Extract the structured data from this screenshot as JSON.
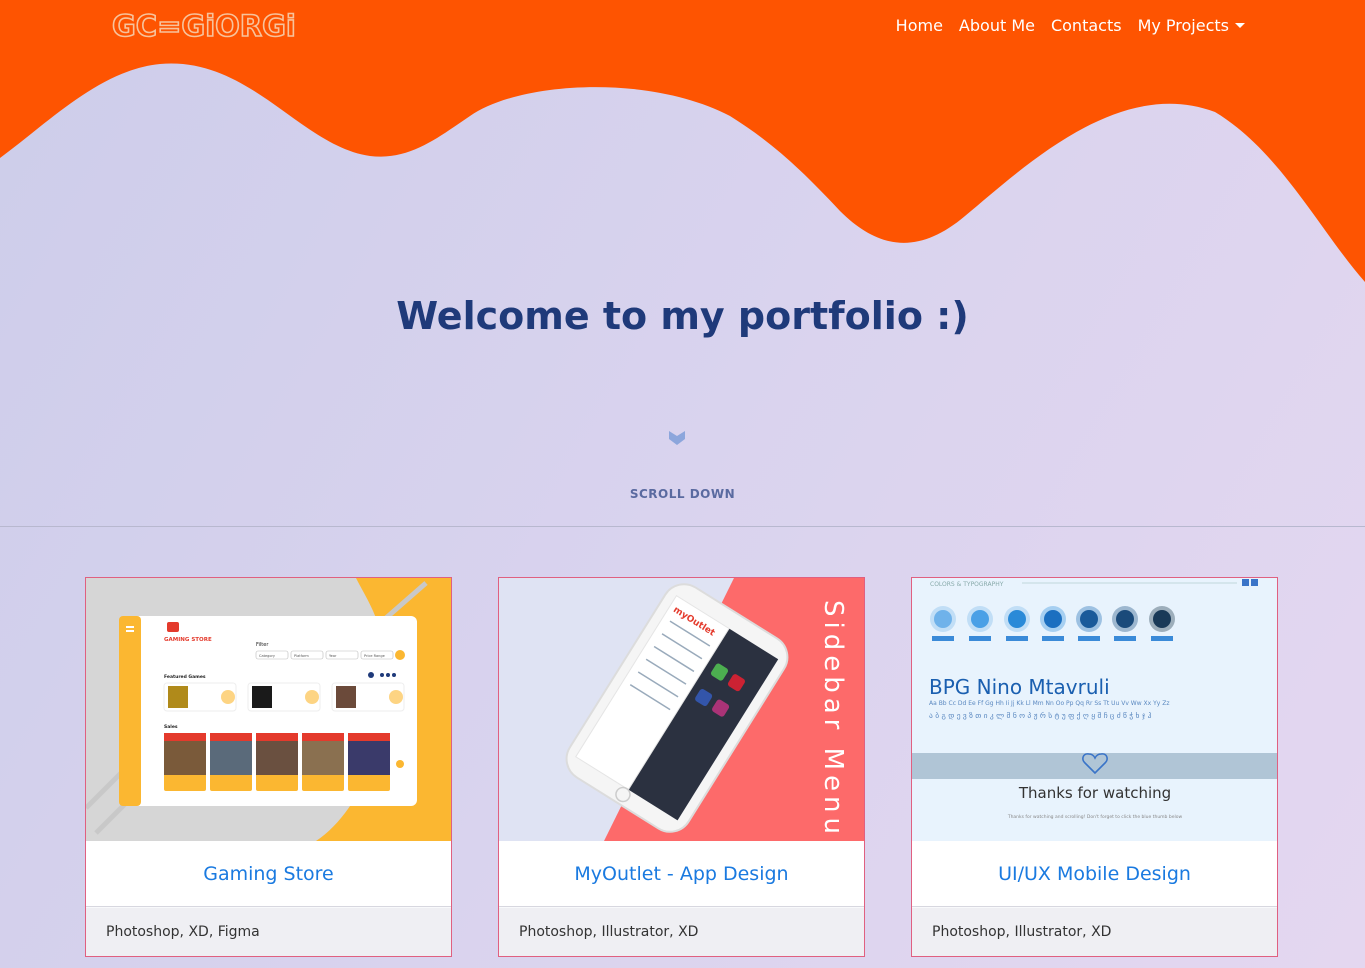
{
  "nav": {
    "brand": "GC=GiORGi",
    "links": [
      "Home",
      "About Me",
      "Contacts",
      "My Projects"
    ]
  },
  "hero": {
    "title": "Welcome to my portfolio :)",
    "scroll_label": "SCROLL DOWN",
    "scroll_icon": "chevron-down-icon"
  },
  "colors": {
    "accent": "#fe5401",
    "title": "#1f3a7a",
    "card_title": "#1a7ae0",
    "card_border": "#e06080"
  },
  "projects": [
    {
      "title": "Gaming Store",
      "tools": "Photoshop, XD, Figma"
    },
    {
      "title": "MyOutlet - App Design",
      "tools": "Photoshop, Illustrator, XD"
    },
    {
      "title": "UI/UX Mobile Design",
      "tools": "Photoshop, Illustrator, XD"
    }
  ],
  "thumbs": {
    "gaming": {
      "store": "GAMING STORE",
      "filter": "Filter",
      "featured": "Featured Games",
      "sales": "Sales",
      "selects": [
        "Category",
        "Platform",
        "Year",
        "Price Range"
      ]
    },
    "outlet": {
      "side_text": "Sidebar Menu",
      "logo": "myOutlet"
    },
    "uiux": {
      "section": "COLORS & TYPOGRAPHY",
      "font_name": "BPG Nino Mtavruli",
      "latin": "Aa Bb Cc Dd Ee Ff Gg Hh Ii Jj Kk Ll Mm Nn Oo Pp Qq Rr Ss Tt Uu Vv Ww Xx Yy Zz",
      "georgian": "ა ბ გ დ ე ვ ზ თ ი კ ლ მ ნ ო პ ჟ რ ს ტ უ ფ ქ ღ ყ შ ჩ ც ძ წ ჭ ხ ჯ ჰ",
      "thanks": "Thanks for watching",
      "thanks_sub": "Thanks for watching and scrolling! Don't forget to click the blue thumb below"
    }
  }
}
